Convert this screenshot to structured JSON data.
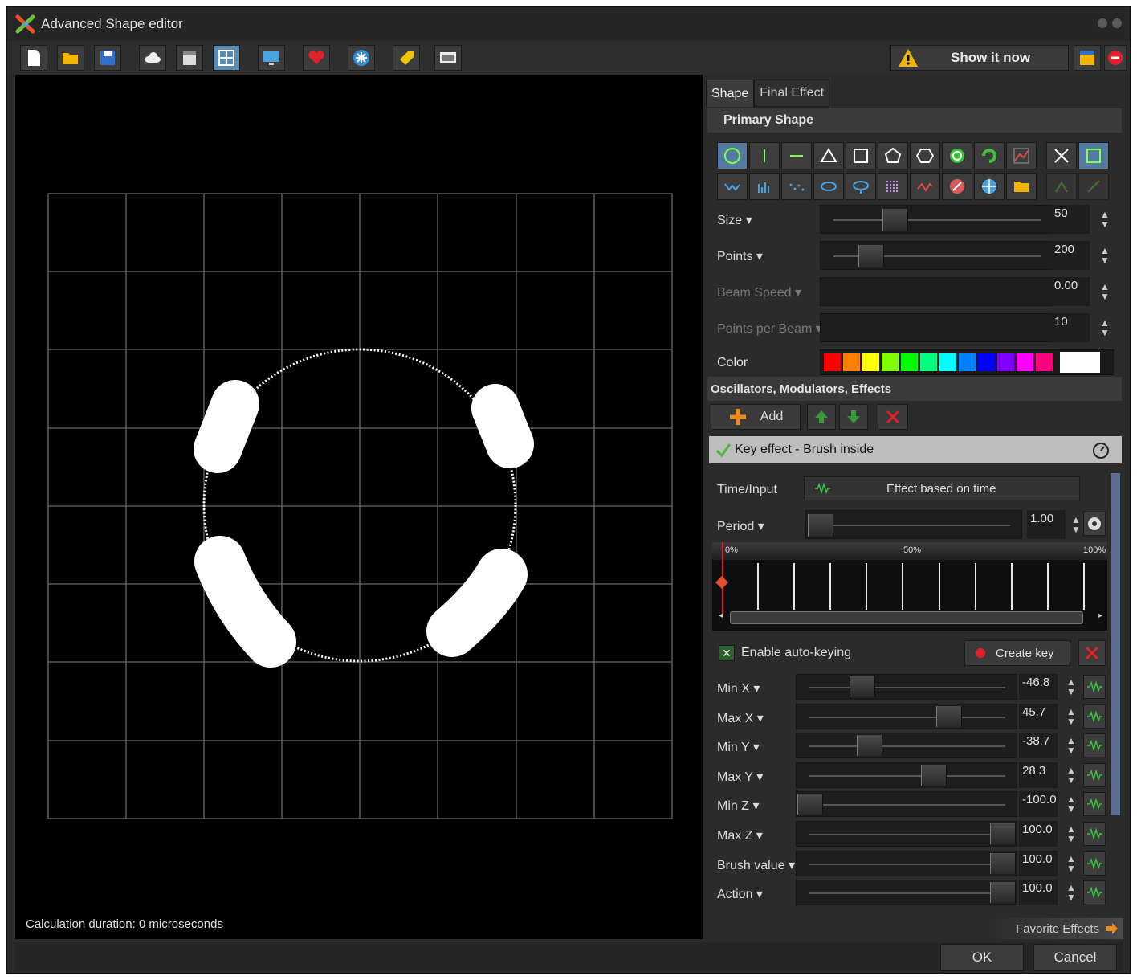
{
  "window": {
    "title": "Advanced Shape editor"
  },
  "toolbar": {
    "buttons": [
      "new-icon",
      "open-folder-icon",
      "save-icon",
      "cloud-icon",
      "clapperboard-icon",
      "grid-icon",
      "monitor-icon",
      "heart-icon",
      "snowflake-icon",
      "tag-icon",
      "image-icon"
    ],
    "show_now_label": "Show it now"
  },
  "viewport": {
    "status": "Calculation duration: 0 microseconds"
  },
  "tabs": [
    {
      "label": "Shape"
    },
    {
      "label": "Final Effect"
    }
  ],
  "primary_shape": {
    "header": "Primary Shape",
    "row1": [
      "circle-icon",
      "vertical-line-icon",
      "horizontal-line-icon",
      "triangle-icon",
      "square-icon",
      "pentagon-icon",
      "hexagon-icon",
      "spiral-icon",
      "rotate-icon",
      "graph-icon",
      "cross-icon",
      "frame-icon"
    ],
    "row2": [
      "wave-icon",
      "bars-icon",
      "dots-icon",
      "ellipse-icon",
      "lens-icon",
      "matrix-icon",
      "sine-icon",
      "compass-icon",
      "globe-icon",
      "folder-icon",
      "node-icon",
      "line-icon"
    ],
    "rows": [
      {
        "label": "Size",
        "value": "50",
        "level": 0.3,
        "dim": false
      },
      {
        "label": "Points",
        "value": "200",
        "level": 0.18,
        "dim": false
      },
      {
        "label": "Beam Speed",
        "value": "0.00",
        "level": null,
        "dim": true
      },
      {
        "label": "Points per Beam",
        "value": "10",
        "level": null,
        "dim": true
      }
    ],
    "color_label": "Color",
    "colors": [
      "#ff0000",
      "#ff7f00",
      "#ffff00",
      "#7fff00",
      "#00ff00",
      "#00ff7f",
      "#00ffff",
      "#007fff",
      "#0000ff",
      "#7f00ff",
      "#ff00ff",
      "#ff007f"
    ]
  },
  "oscillators": {
    "header": "Oscillators, Modulators, Effects",
    "add_label": "Add",
    "effect_name": "Key effect - Brush inside",
    "time_input_label": "Time/Input",
    "time_input_value": "Effect based on time",
    "period_label": "Period",
    "period_value": "1.00",
    "timeline_labels": [
      "0%",
      "50%",
      "100%"
    ],
    "auto_key_label": "Enable auto-keying",
    "create_key_label": "Create key",
    "modulators": [
      {
        "label": "Min X",
        "value": "-46.8",
        "level": 0.27
      },
      {
        "label": "Max X",
        "value": "45.7",
        "level": 0.72
      },
      {
        "label": "Min Y",
        "value": "-38.7",
        "level": 0.31
      },
      {
        "label": "Max Y",
        "value": "28.3",
        "level": 0.64
      },
      {
        "label": "Min Z",
        "value": "-100.0",
        "level": 0.0
      },
      {
        "label": "Max Z",
        "value": "100.0",
        "level": 1.0
      },
      {
        "label": "Brush value",
        "value": "100.0",
        "level": 1.0
      },
      {
        "label": "Action",
        "value": "100.0",
        "level": 1.0
      }
    ],
    "favorite_label": "Favorite Effects"
  },
  "dialog": {
    "ok_label": "OK",
    "cancel_label": "Cancel"
  }
}
